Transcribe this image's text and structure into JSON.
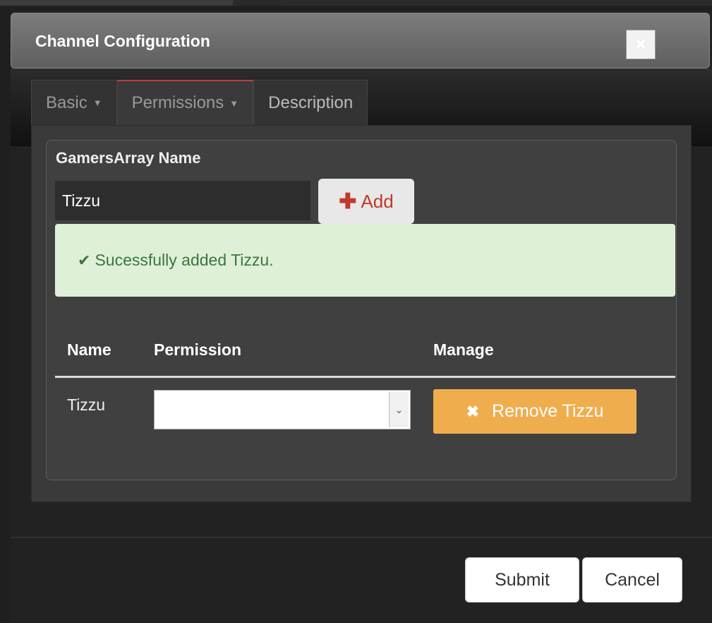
{
  "modal": {
    "title": "Channel Configuration",
    "close_glyph": "✖"
  },
  "tabs": [
    {
      "label": "Basic",
      "caret": "▼",
      "active": false
    },
    {
      "label": "Permissions",
      "caret": "▼",
      "active": true
    },
    {
      "label": "Description",
      "caret": "",
      "active": false
    }
  ],
  "form": {
    "group_label": "GamersArray Name",
    "name_value": "Tizzu",
    "add_icon": "✚",
    "add_label": "Add"
  },
  "alert": {
    "icon": "✔",
    "message": "Sucessfully added Tizzu."
  },
  "table": {
    "headers": [
      "Name",
      "Permission",
      "Manage"
    ],
    "rows": [
      {
        "name": "Tizzu",
        "permission": "",
        "remove_icon": "✖",
        "remove_label": "Remove Tizzu"
      }
    ]
  },
  "footer": {
    "submit_label": "Submit",
    "cancel_label": "Cancel"
  },
  "colors": {
    "alert_bg": "#dff0d8",
    "alert_text": "#3c763d",
    "warning_button": "#f0ad4e",
    "active_tab_accent": "#c93a3a",
    "add_text": "#c0392b"
  }
}
